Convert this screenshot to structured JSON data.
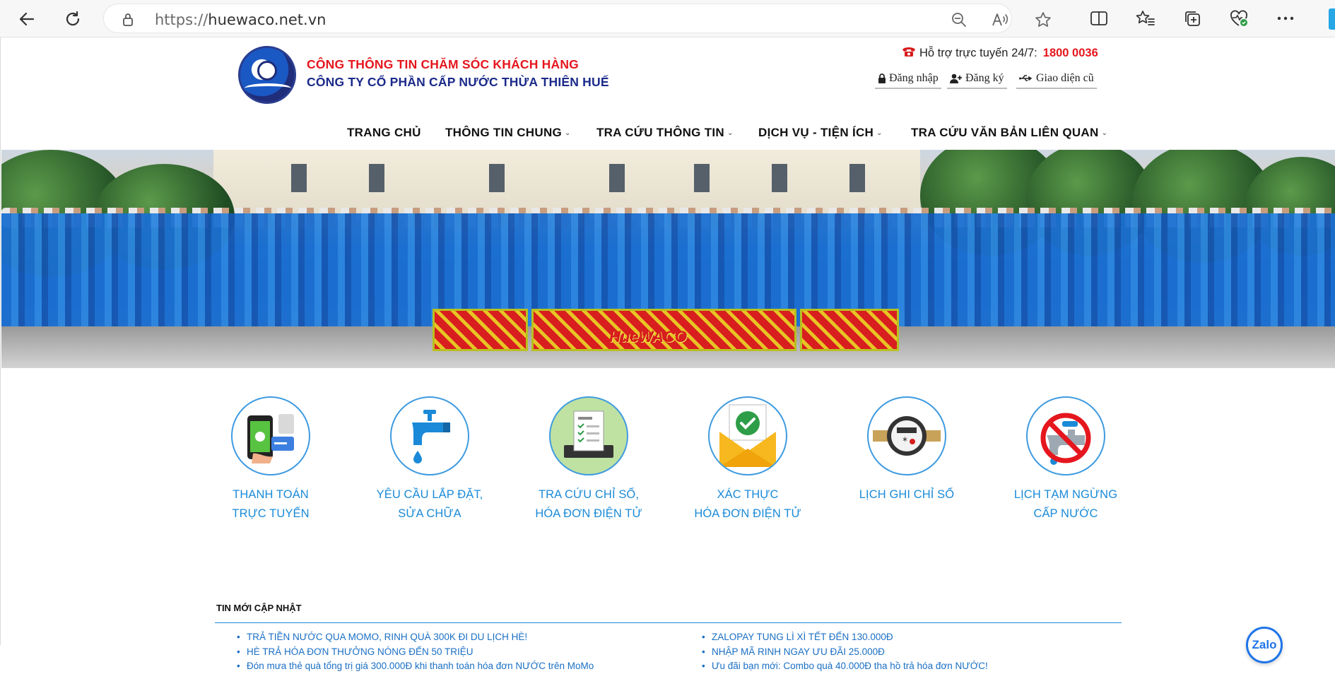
{
  "browser": {
    "url_protocol": "https://",
    "url_host": "huewaco.net.vn"
  },
  "header": {
    "company_line1": "CÔNG THÔNG TIN CHĂM SÓC KHÁCH HÀNG",
    "company_line2": "CÔNG TY CỔ PHẦN CẤP NƯỚC THỪA THIÊN HUẾ",
    "support_label": "Hỗ trợ trực tuyến 24/7:",
    "support_phone": "1800 0036",
    "login": "Đăng nhập",
    "register": "Đăng ký",
    "old_ui": "Giao diện cũ"
  },
  "menu": [
    {
      "label": "TRANG CHỦ"
    },
    {
      "label": "THÔNG TIN CHUNG"
    },
    {
      "label": "TRA CỨU THÔNG TIN"
    },
    {
      "label": "DỊCH VỤ - TIỆN ÍCH"
    },
    {
      "label": "TRA CỨU VĂN BẢN LIÊN QUAN"
    }
  ],
  "banner": {
    "sign_text": "HueWACO"
  },
  "services": [
    {
      "line1": "THANH TOÁN",
      "line2": "TRỰC TUYẾN",
      "icon": "online-payment-icon"
    },
    {
      "line1": "YÊU CẦU LẮP ĐẶT,",
      "line2": "SỬA CHỮA",
      "icon": "water-tap-icon"
    },
    {
      "line1": "TRA CỨU CHỈ SỐ,",
      "line2": "HÓA ĐƠN ĐIỆN TỬ",
      "icon": "e-invoice-icon"
    },
    {
      "line1": "XÁC THỰC",
      "line2": "HÓA ĐƠN ĐIỆN TỬ",
      "icon": "verify-envelope-icon"
    },
    {
      "line1": "LỊCH GHI CHỈ SỐ",
      "line2": "",
      "icon": "water-meter-icon"
    },
    {
      "line1": "LỊCH TẠM NGỪNG",
      "line2": "CẤP NƯỚC",
      "icon": "no-water-icon"
    }
  ],
  "news": {
    "title": "TIN MỚI CẬP NHẬT",
    "left": [
      "TRẢ TIỀN NƯỚC QUA MOMO, RINH QUÀ 300K ĐI DU LỊCH HÈ!",
      "HÈ TRẢ HÓA ĐƠN THƯỞNG NÓNG ĐẾN 50 TRIỆU",
      "Đón mưa thẻ quà tổng trị giá 300.000Đ khi thanh toán hóa đơn NƯỚC trên MoMo"
    ],
    "right": [
      "ZALOPAY TUNG LÌ XÌ TẾT ĐẾN 130.000Đ",
      "NHẬP MÃ RINH NGAY ƯU ĐÃI 25.000Đ",
      "Ưu đãi bạn mới: Combo quà 40.000Đ tha hồ trả hóa đơn NƯỚC!"
    ]
  },
  "zalo": {
    "label": "Zalo"
  }
}
